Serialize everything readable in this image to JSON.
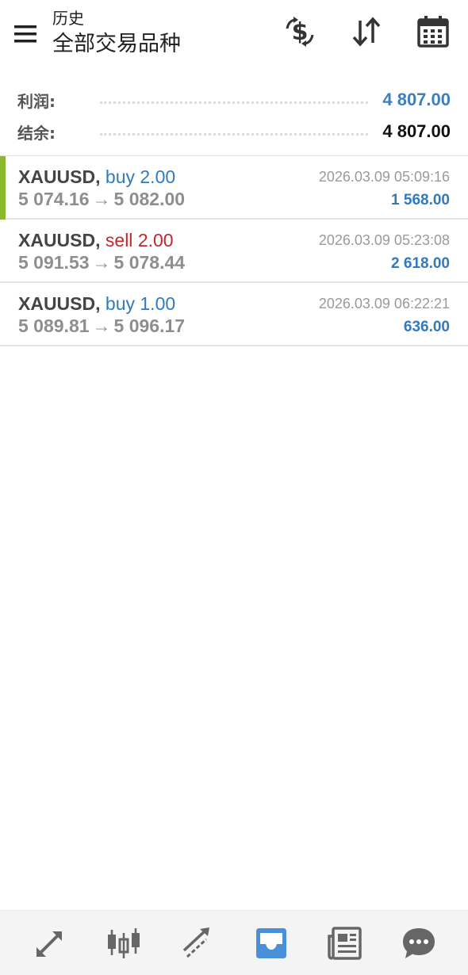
{
  "header": {
    "title_small": "历史",
    "title_big": "全部交易品种",
    "icons": [
      "currency-exchange-icon",
      "sort-icon",
      "calendar-icon"
    ]
  },
  "summary": {
    "profit_label": "利润:",
    "profit_value": "4 807.00",
    "balance_label": "结余:",
    "balance_value": "4 807.00"
  },
  "deals": [
    {
      "symbol": "XAUUSD",
      "type": "buy",
      "volume": "2.00",
      "open_price": "5 074.16",
      "close_price": "5 082.00",
      "time": "2026.03.09 05:09:16",
      "profit": "1 568.00"
    },
    {
      "symbol": "XAUUSD",
      "type": "sell",
      "volume": "2.00",
      "open_price": "5 091.53",
      "close_price": "5 078.44",
      "time": "2026.03.09 05:23:08",
      "profit": "2 618.00"
    },
    {
      "symbol": "XAUUSD",
      "type": "buy",
      "volume": "1.00",
      "open_price": "5 089.81",
      "close_price": "5 096.17",
      "time": "2026.03.09 06:22:21",
      "profit": "636.00"
    }
  ],
  "colors": {
    "accent_green": "#8ab82e",
    "buy_blue": "#2f7ac2",
    "sell_red": "#c0282d",
    "active_nav_blue": "#4a90d9"
  },
  "bottom_nav": {
    "items": [
      "quotes-icon",
      "chart-icon",
      "trade-icon",
      "history-icon",
      "news-icon",
      "chat-icon"
    ],
    "active": "history-icon"
  }
}
